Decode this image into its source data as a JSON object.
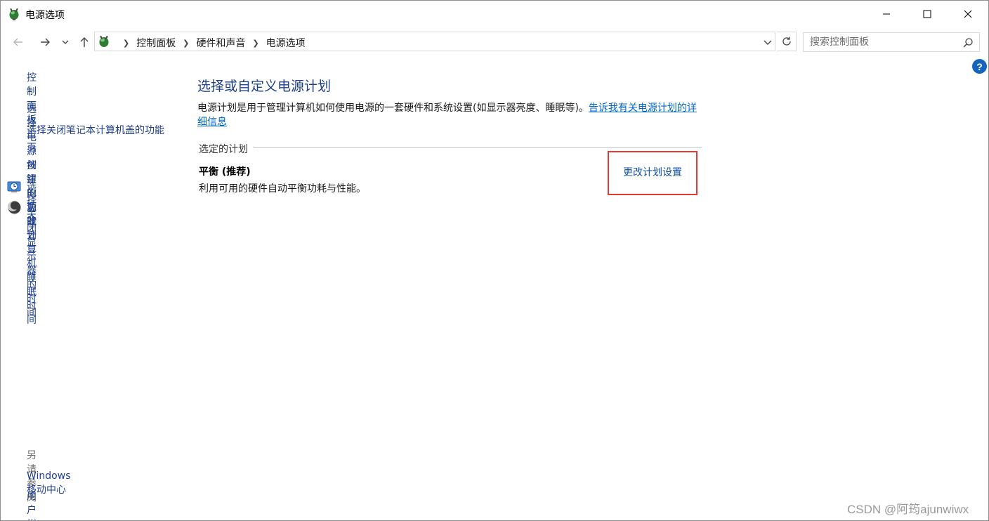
{
  "window": {
    "title": "电源选项",
    "icon": "power-options-icon"
  },
  "titlebar_buttons": {
    "minimize_icon": "minimize-icon",
    "maximize_icon": "maximize-icon",
    "close_icon": "close-icon"
  },
  "navigation": {
    "back_icon": "arrow-left-icon",
    "forward_icon": "arrow-right-icon",
    "recent_icon": "chevron-down-icon",
    "up_icon": "arrow-up-icon"
  },
  "address_bar": {
    "breadcrumbs": [
      "控制面板",
      "硬件和声音",
      "电源选项"
    ],
    "dropdown_icon": "chevron-down-icon",
    "refresh_icon": "refresh-icon"
  },
  "search": {
    "placeholder": "搜索控制面板",
    "icon": "search-icon"
  },
  "help_label": "?",
  "sidebar": {
    "home": "控制面板主页",
    "items": [
      {
        "label": "选择电源按钮的功能"
      },
      {
        "label": "选择关闭笔记本计算机盖的功能"
      },
      {
        "label": "创建电源计划"
      },
      {
        "label": "选择关闭显示器的时间",
        "icon": "display-timer-icon"
      },
      {
        "label": "更改计算机睡眠时间",
        "icon": "moon-sleep-icon"
      }
    ],
    "see_also_title": "另请参阅",
    "see_also": [
      "Windows 移动中心",
      "用户帐户"
    ]
  },
  "main": {
    "heading": "选择或自定义电源计划",
    "description": "电源计划是用于管理计算机如何使用电源的一套硬件和系统设置(如显示器亮度、睡眠等)。",
    "description_link": "告诉我有关电源计划的详细信息",
    "section_label": "选定的计划",
    "plan_name": "平衡 (推荐)",
    "plan_description": "利用可用的硬件自动平衡功耗与性能。",
    "change_plan_link": "更改计划设置"
  },
  "watermark": "CSDN @阿筠ajunwiwx",
  "colors": {
    "link": "#1f3f8f",
    "heading": "#1e3f8c",
    "highlight_box": "#e53935",
    "help_badge": "#1565c0"
  }
}
